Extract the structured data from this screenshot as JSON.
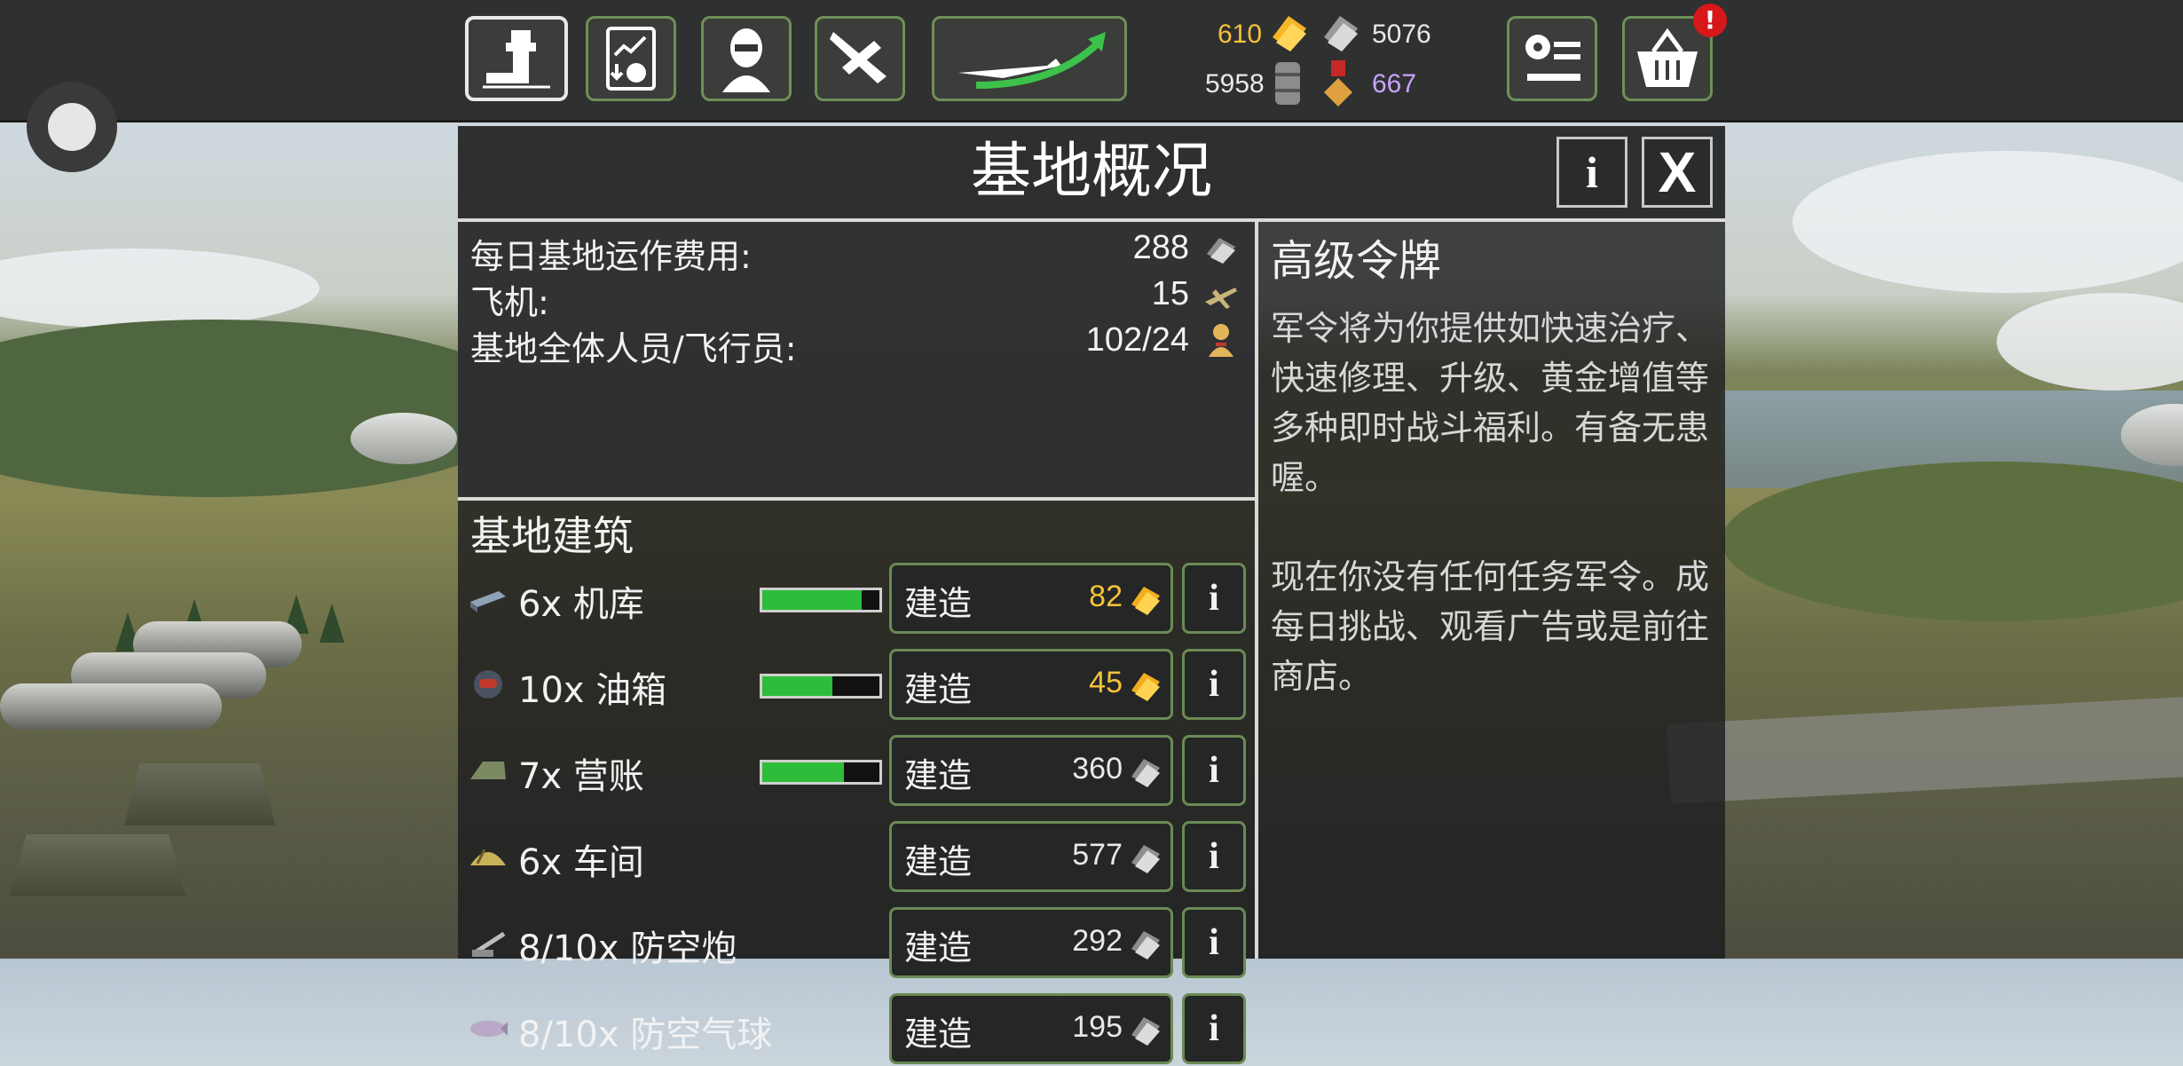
{
  "resources": {
    "gold": "610",
    "silver": "5076",
    "fuel": "5958",
    "medals": "667"
  },
  "notification_badge": "!",
  "panel": {
    "title": "基地概况",
    "info_button": "i",
    "close_button": "X",
    "stats": [
      {
        "label": "每日基地运作费用:",
        "value": "288",
        "icon": "silver-icon"
      },
      {
        "label": "飞机:",
        "value": "15",
        "icon": "plane-icon"
      },
      {
        "label": "基地全体人员/飞行员:",
        "value": "102/24",
        "icon": "pilot-icon"
      }
    ],
    "buildings_title": "基地建筑",
    "buildings": [
      {
        "label": "6x 机库",
        "progress": 0.85,
        "build_label": "建造",
        "cost": "82",
        "currency": "gold",
        "info": "i"
      },
      {
        "label": "10x 油箱",
        "progress": 0.6,
        "build_label": "建造",
        "cost": "45",
        "currency": "gold",
        "info": "i"
      },
      {
        "label": "7x 营账",
        "progress": 0.7,
        "build_label": "建造",
        "cost": "360",
        "currency": "silver",
        "info": "i"
      },
      {
        "label": "6x 车间",
        "progress": null,
        "build_label": "建造",
        "cost": "577",
        "currency": "silver",
        "info": "i"
      },
      {
        "label": "8/10x 防空炮",
        "progress": null,
        "build_label": "建造",
        "cost": "292",
        "currency": "silver",
        "info": "i"
      },
      {
        "label": "8/10x 防空气球",
        "progress": null,
        "build_label": "建造",
        "cost": "195",
        "currency": "silver",
        "info": "i"
      }
    ],
    "side": {
      "title": "高级令牌",
      "text1": "军令将为你提供如快速治疗、快速修理、升级、黄金增值等多种即时战斗福利。有备无患喔。",
      "text2": "现在你没有任何任务军令。成每日挑战、观看广告或是前往商店。"
    }
  },
  "colors": {
    "gold": "#f5c23a",
    "silver_text": "#e8e8e8",
    "purple": "#c9a3ff",
    "progress": "#2dbd3a",
    "button_border": "#6b8a55"
  }
}
